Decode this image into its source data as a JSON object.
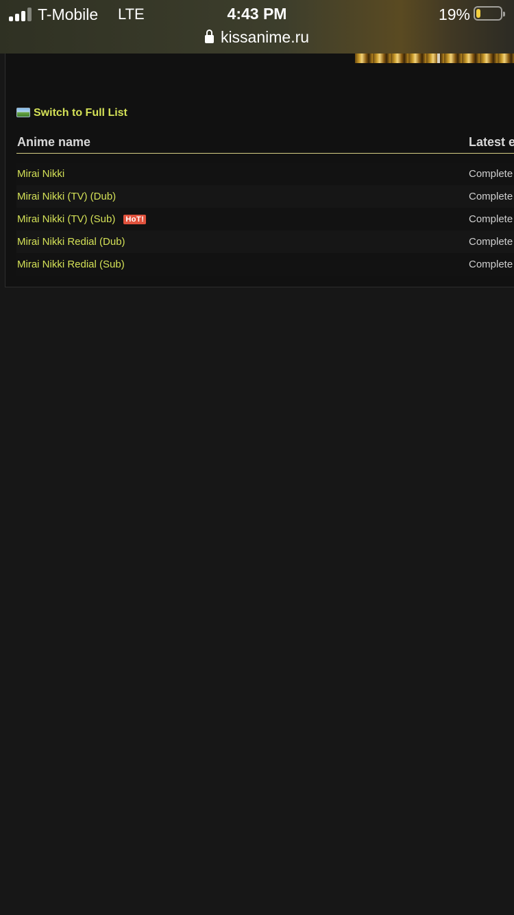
{
  "status_bar": {
    "carrier": "T-Mobile",
    "network": "LTE",
    "time": "4:43 PM",
    "battery_percent": "19%",
    "battery_level": 0.19,
    "url": "kissanime.ru"
  },
  "list": {
    "switch_link": "Switch to Full List",
    "columns": {
      "name": "Anime name",
      "latest": "Latest e"
    },
    "rows": [
      {
        "title": "Mirai Nikki",
        "status": "Complete",
        "badge": ""
      },
      {
        "title": "Mirai Nikki (TV) (Dub)",
        "status": "Complete",
        "badge": ""
      },
      {
        "title": "Mirai Nikki (TV) (Sub)",
        "status": "Complete",
        "badge": "HoT!"
      },
      {
        "title": "Mirai Nikki Redial (Dub)",
        "status": "Complete",
        "badge": ""
      },
      {
        "title": "Mirai Nikki Redial (Sub)",
        "status": "Complete",
        "badge": ""
      }
    ]
  },
  "colors": {
    "link": "#d4e157",
    "background": "#171717",
    "hot_badge": "#e0523d"
  }
}
